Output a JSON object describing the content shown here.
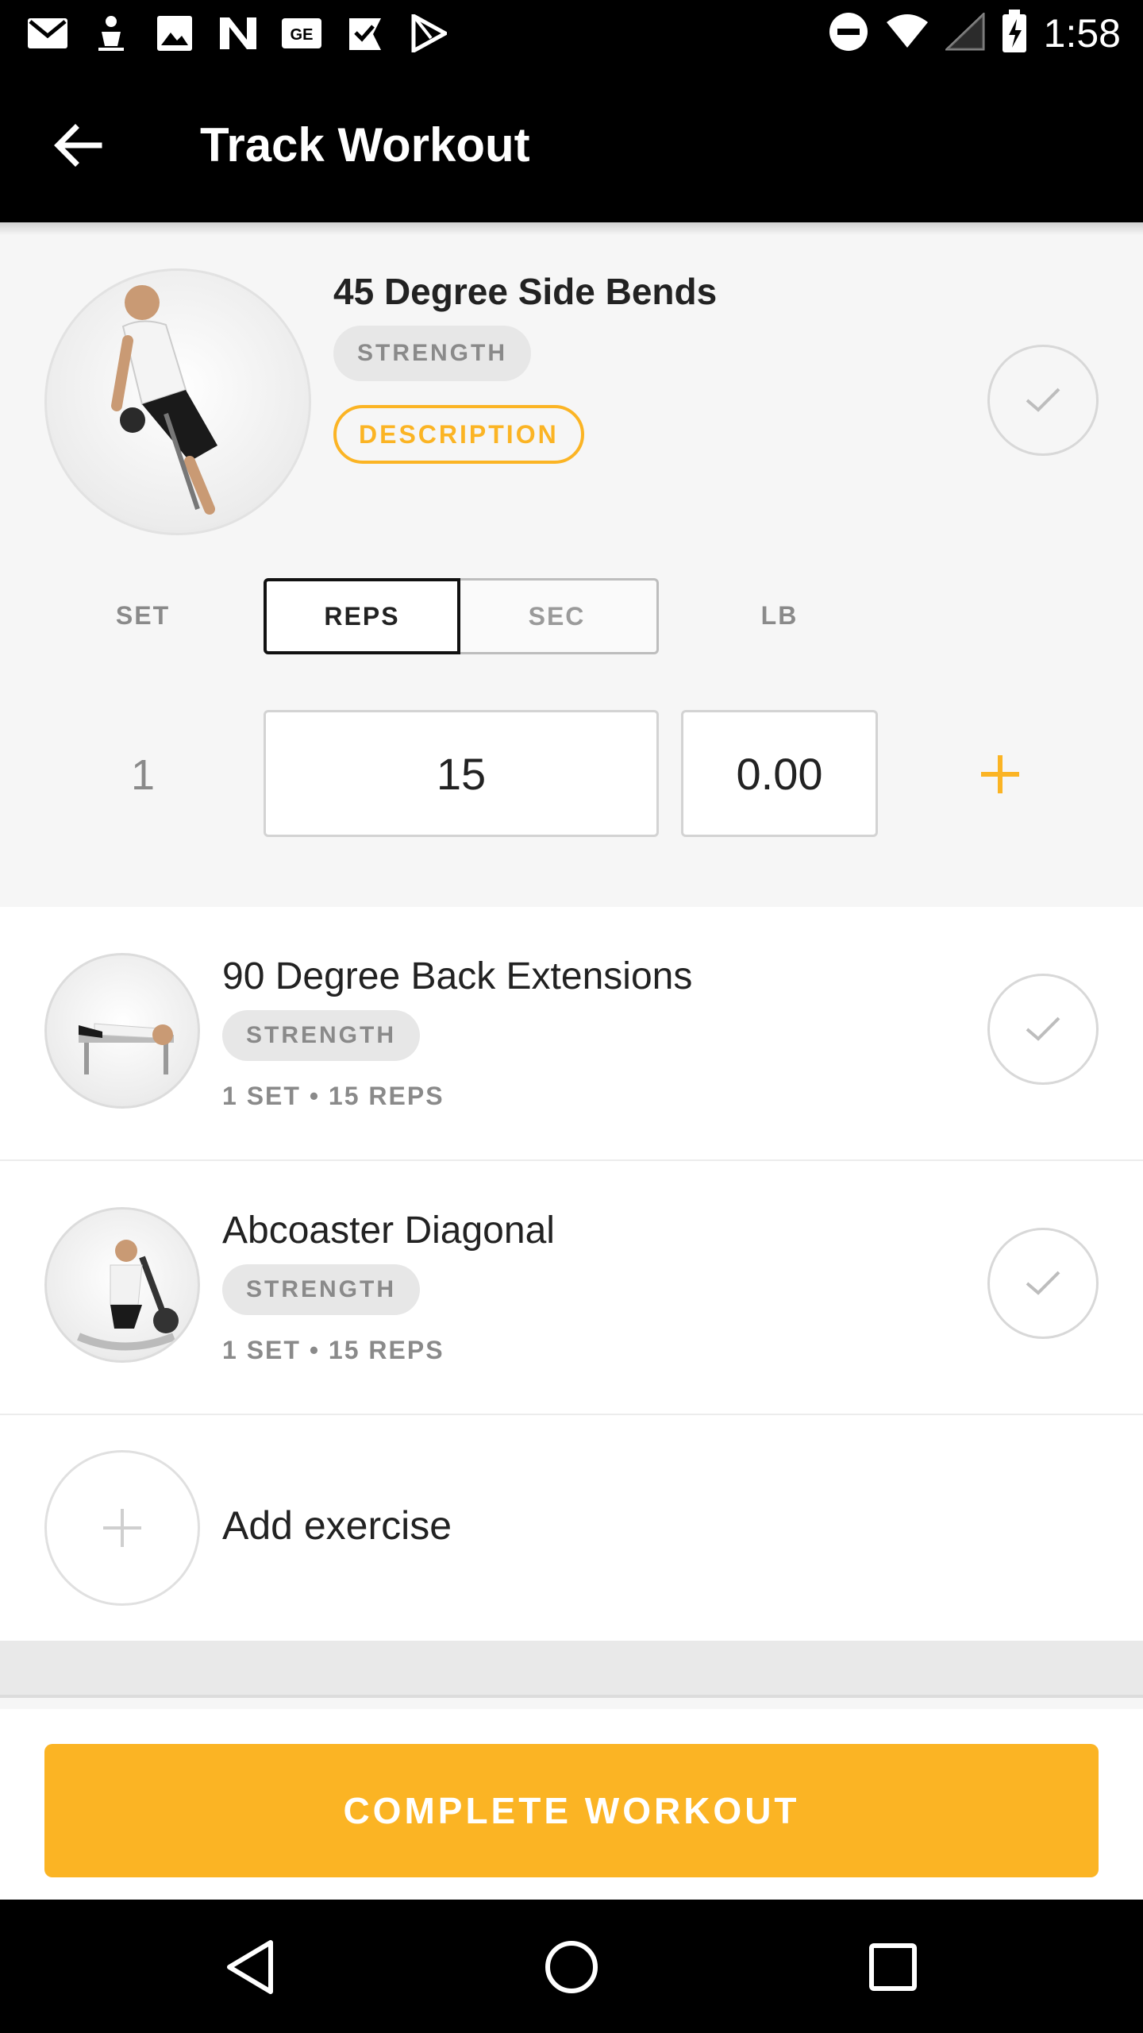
{
  "status_bar": {
    "time": "1:58",
    "left_icons": [
      "gmail-icon",
      "app-icon",
      "image-icon",
      "news-icon",
      "ge-icon",
      "check-flag-icon",
      "play-store-icon"
    ],
    "right_icons": [
      "do-not-disturb-icon",
      "wifi-icon",
      "signal-icon",
      "battery-icon"
    ]
  },
  "app_bar": {
    "title": "Track Workout",
    "back_icon": "arrow-left-icon"
  },
  "active_exercise": {
    "name": "45 Degree Side Bends",
    "category": "STRENGTH",
    "description_label": "DESCRIPTION",
    "columns": {
      "set": "SET",
      "reps": "REPS",
      "sec": "SEC",
      "lb": "LB"
    },
    "row": {
      "set": "1",
      "reps": "15",
      "weight": "0.00"
    }
  },
  "exercises": [
    {
      "name": "90 Degree Back Extensions",
      "category": "STRENGTH",
      "meta": "1 SET • 15 REPS"
    },
    {
      "name": "Abcoaster Diagonal",
      "category": "STRENGTH",
      "meta": "1 SET • 15 REPS"
    }
  ],
  "add_exercise_label": "Add exercise",
  "complete_button": "COMPLETE WORKOUT",
  "colors": {
    "accent": "#fbb424",
    "app_bar": "#000000",
    "chip_bg": "#e7e7e7",
    "muted_text": "#8a8a8a"
  }
}
